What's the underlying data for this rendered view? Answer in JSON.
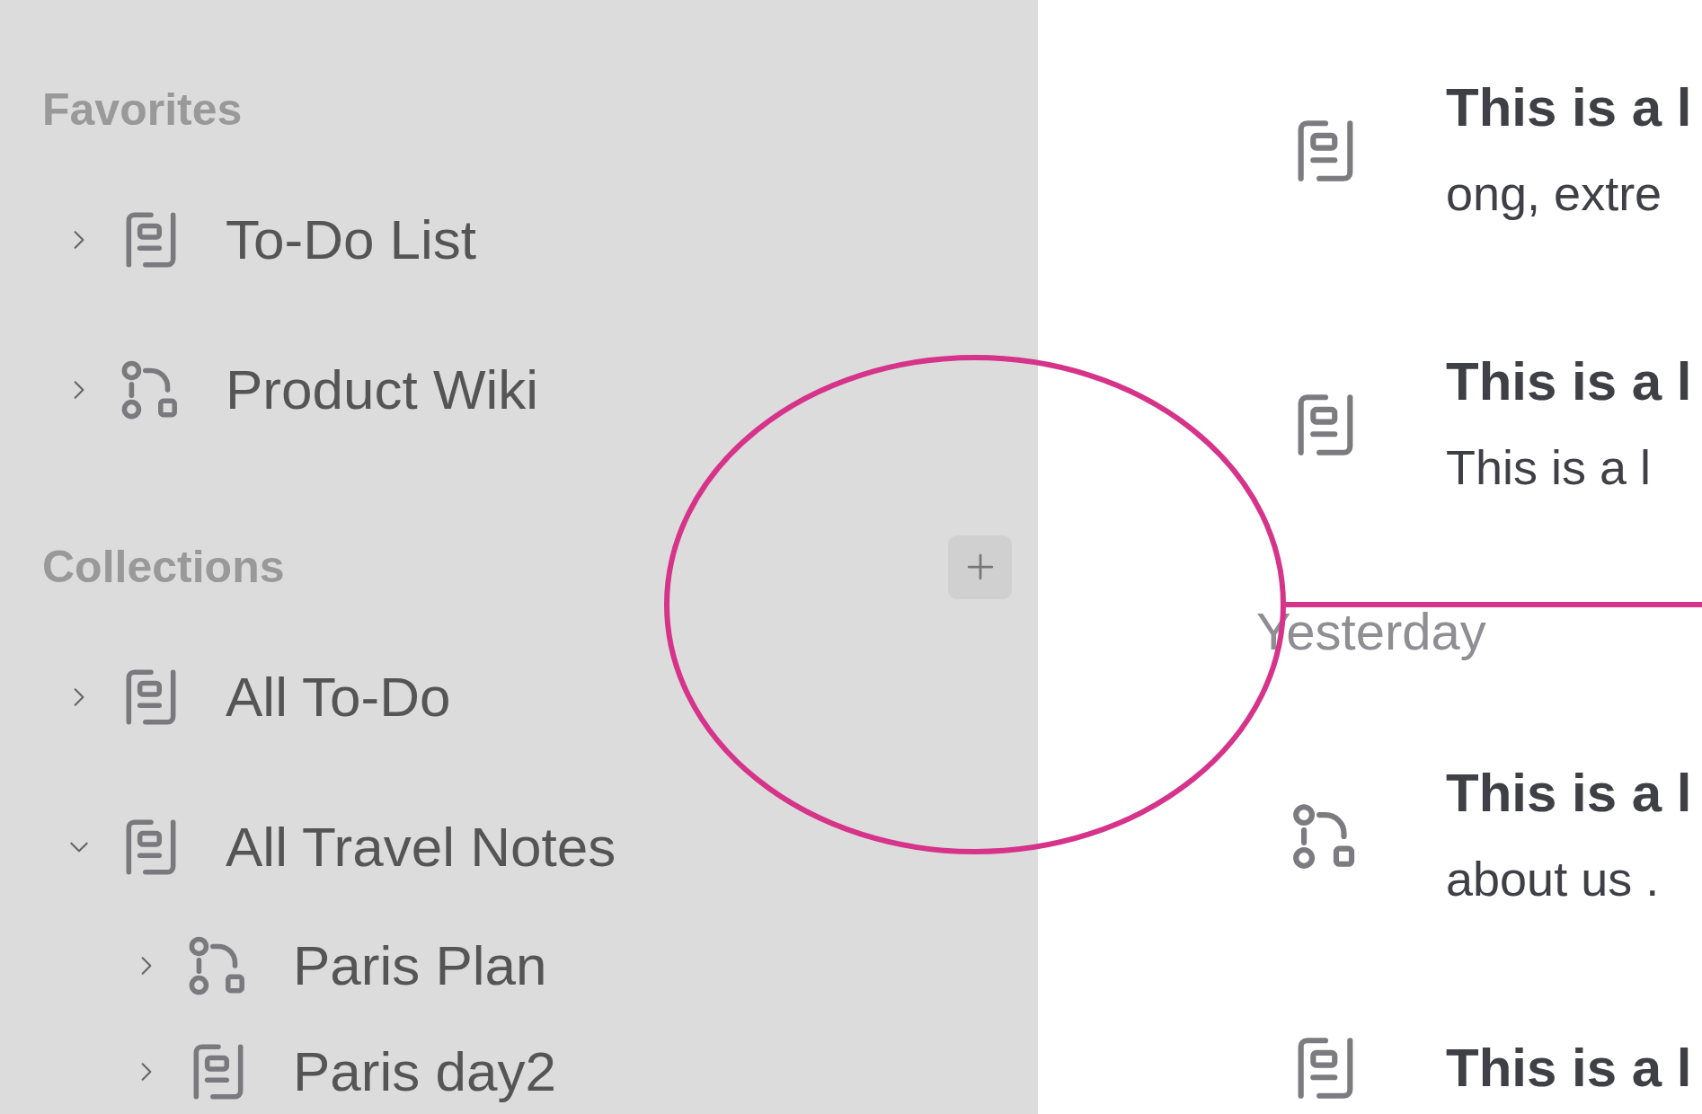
{
  "sidebar": {
    "sections": [
      {
        "title": "Favorites",
        "has_add": false,
        "items": [
          {
            "label": "To-Do List",
            "kind": "document",
            "expanded": false
          },
          {
            "label": "Product Wiki",
            "kind": "flow",
            "expanded": false
          }
        ]
      },
      {
        "title": "Collections",
        "has_add": true,
        "items": [
          {
            "label": "All To-Do",
            "kind": "document",
            "expanded": false
          },
          {
            "label": "All Travel Notes",
            "kind": "document",
            "expanded": true,
            "children": [
              {
                "label": "Paris Plan",
                "kind": "flow",
                "expanded": false
              },
              {
                "label": "Paris day2",
                "kind": "document",
                "expanded": false
              }
            ]
          }
        ]
      }
    ]
  },
  "main": {
    "groups": [
      {
        "items": [
          {
            "title": "This is a l",
            "subtitle": "ong, extre",
            "kind": "document"
          },
          {
            "title": "This is a l",
            "subtitle": "This is a l",
            "kind": "document"
          }
        ]
      },
      {
        "heading": "Yesterday",
        "items": [
          {
            "title": "This is a l",
            "subtitle": "about us .",
            "kind": "flow"
          },
          {
            "title": "This is a l",
            "kind": "document"
          }
        ]
      }
    ]
  }
}
